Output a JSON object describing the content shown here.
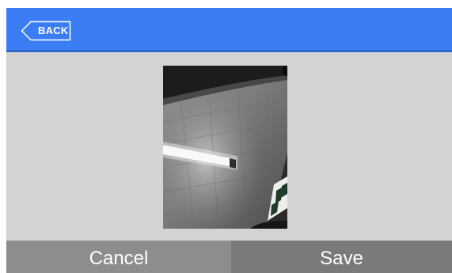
{
  "header": {
    "back_label": "BACK"
  },
  "preview": {
    "description_icon": "captured-photo"
  },
  "footer": {
    "cancel_label": "Cancel",
    "save_label": "Save"
  },
  "colors": {
    "header_bg": "#3b7df4",
    "content_bg": "#d4d3d1",
    "cancel_bg": "#8d8d8b",
    "save_bg": "#7a7a78",
    "text": "#ffffff"
  }
}
